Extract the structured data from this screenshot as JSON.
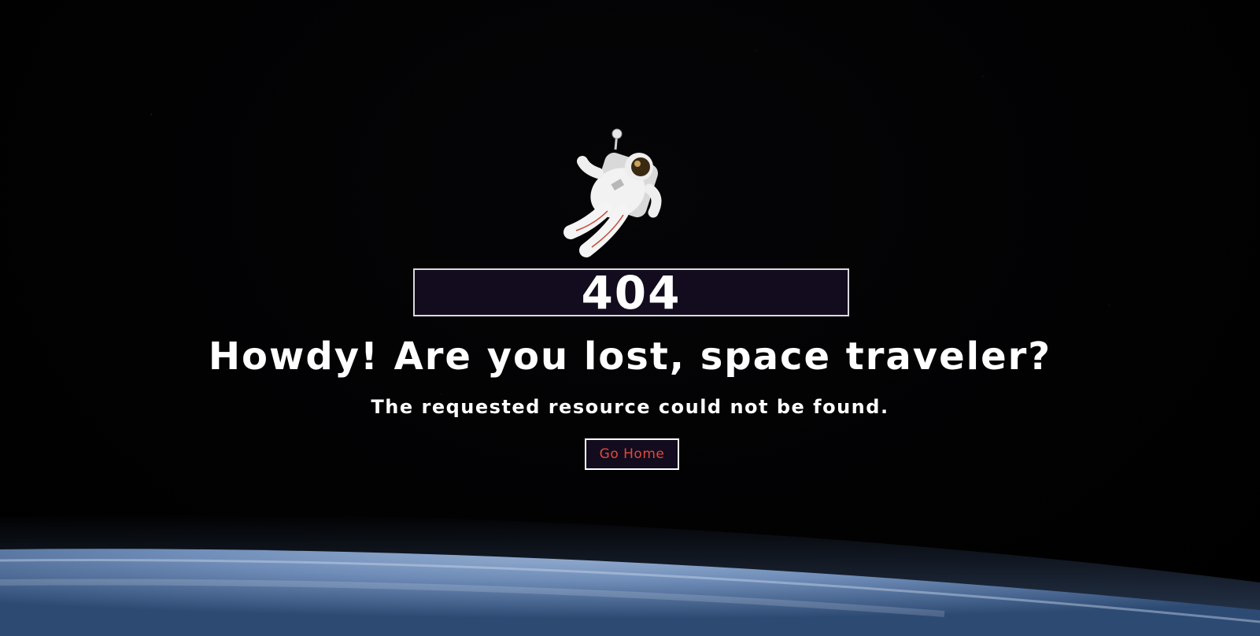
{
  "error": {
    "code": "404",
    "headline": "Howdy! Are you lost, space traveler?",
    "message": "The requested resource could not be found."
  },
  "actions": {
    "home_label": "Go Home"
  },
  "colors": {
    "background": "#000000",
    "panel": "#120c1e",
    "border": "#ffffff",
    "button_text": "#e0493b",
    "text": "#ffffff"
  },
  "imagery": {
    "figure": "astronaut",
    "horizon": "earth"
  }
}
